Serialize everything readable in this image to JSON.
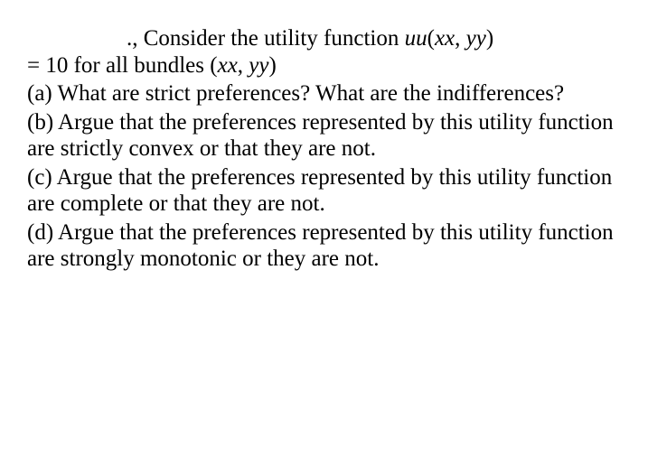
{
  "intro": {
    "lead_punct": ".,",
    "line1_text": " Consider the utility function ",
    "uu": "uu",
    "open": "(",
    "xx1": "xx",
    "comma1": ", ",
    "yy1": "yy",
    "close": ")",
    "line2_prefix": "= 10 for all bundles (",
    "xx2": "xx",
    "comma2": ", ",
    "yy2": "yy",
    "close2": ")"
  },
  "parts": {
    "a": "(a) What are strict preferences? What are the indifferences?",
    "b": "(b) Argue that the preferences represented by this utility function are strictly convex or that they are not.",
    "c": "(c) Argue that the preferences represented by this utility function are complete or that they are not.",
    "d": "(d) Argue that the preferences represented by this utility function are strongly monotonic or they are not."
  }
}
